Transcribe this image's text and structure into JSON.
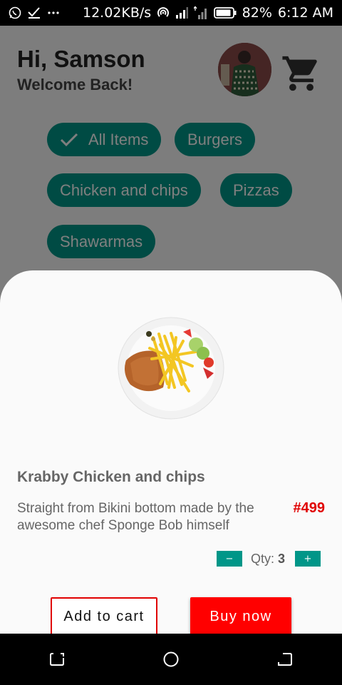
{
  "status_bar": {
    "speed": "12.02KB/s",
    "battery": "82%",
    "time": "6:12 AM",
    "icons": [
      "whatsapp-icon",
      "check-icon",
      "more-icon",
      "hotspot-icon",
      "signal-icon",
      "data-signal-icon",
      "battery-icon"
    ]
  },
  "header": {
    "greeting": "Hi, Samson",
    "subtitle": "Welcome Back!"
  },
  "categories": [
    {
      "label": "All Items",
      "selected": true
    },
    {
      "label": "Burgers",
      "selected": false
    },
    {
      "label": "Chicken and chips",
      "selected": false
    },
    {
      "label": "Pizzas",
      "selected": false
    },
    {
      "label": "Shawarmas",
      "selected": false
    }
  ],
  "item": {
    "title": "Krabby Chicken and chips",
    "description": "Straight from Bikini bottom made by the awesome chef Sponge Bob himself",
    "price": "#499",
    "qty_label": "Qty:",
    "qty_value": "3",
    "minus_label": "−",
    "plus_label": "+"
  },
  "actions": {
    "add_to_cart": "Add to cart",
    "buy_now": "Buy now"
  },
  "colors": {
    "accent": "#009688",
    "price": "#e00000",
    "buy": "#ff0000"
  }
}
